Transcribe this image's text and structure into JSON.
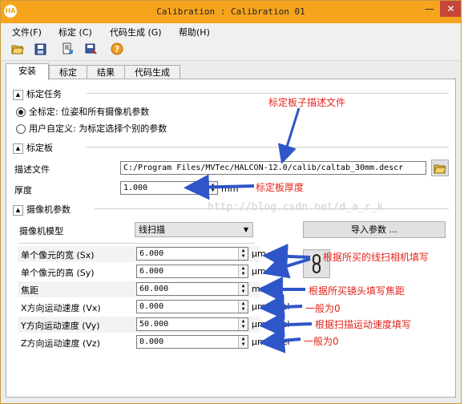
{
  "window": {
    "title": "Calibration : Calibration 01",
    "minimize_glyph": "—",
    "close_glyph": "✕",
    "app_icon_text": "HA"
  },
  "menu": [
    {
      "label": "文件(F)"
    },
    {
      "label": "标定 (C)"
    },
    {
      "label": "代码生成 (G)"
    },
    {
      "label": "帮助(H)"
    }
  ],
  "toolbar": {
    "icons": [
      "open-folder-icon",
      "save-icon",
      "load-icon",
      "save-as-icon",
      "help-icon"
    ]
  },
  "tabs": [
    {
      "label": "安装",
      "active": true
    },
    {
      "label": "标定",
      "active": false
    },
    {
      "label": "结果",
      "active": false
    },
    {
      "label": "代码生成",
      "active": false
    }
  ],
  "task_section": {
    "title": "标定任务",
    "options": [
      {
        "label": "全标定: 位姿和所有摄像机参数",
        "selected": true
      },
      {
        "label": "用户自定义: 为标定选择个别的参数",
        "selected": false
      }
    ]
  },
  "plate_section": {
    "title": "标定板",
    "desc_label": "描述文件",
    "desc_value": "C:/Program Files/MVTec/HALCON-12.0/calib/caltab_30mm.descr",
    "thickness_label": "厚度",
    "thickness_value": "1.000",
    "thickness_unit": "mm"
  },
  "camera_section": {
    "title": "摄像机参数",
    "model_label": "摄像机模型",
    "model_value": "线扫描",
    "import_button": "导入参数 ...",
    "params": [
      {
        "label": "单个像元的宽 (Sx)",
        "value": "6.000",
        "unit": "μm"
      },
      {
        "label": "单个像元的高 (Sy)",
        "value": "6.000",
        "unit": "μm"
      },
      {
        "label": "焦距",
        "value": "60.000",
        "unit": "mm"
      },
      {
        "label": "X方向运动速度 (Vx)",
        "value": "0.000",
        "unit": "μm/pixel"
      },
      {
        "label": "Y方向运动速度 (Vy)",
        "value": "50.000",
        "unit": "μm/pixel"
      },
      {
        "label": "Z方向运动速度 (Vz)",
        "value": "0.000",
        "unit": "μm/pixel"
      }
    ]
  },
  "annotations": {
    "desc_file": "标定板子描述文件",
    "thickness": "标定板厚度",
    "pixel_size": "根据所买的线扫相机填写",
    "focal": "根据所买镜头填写焦距",
    "vx": "一般为0",
    "vy": "根据扫描运动速度填写",
    "vz": "一般为0"
  },
  "watermark": "http://blog.csdn.net/d_a_r_k",
  "colors": {
    "titlebar": "#f7a41d",
    "annotation": "#e2231a",
    "arrow": "#2f56c8"
  }
}
